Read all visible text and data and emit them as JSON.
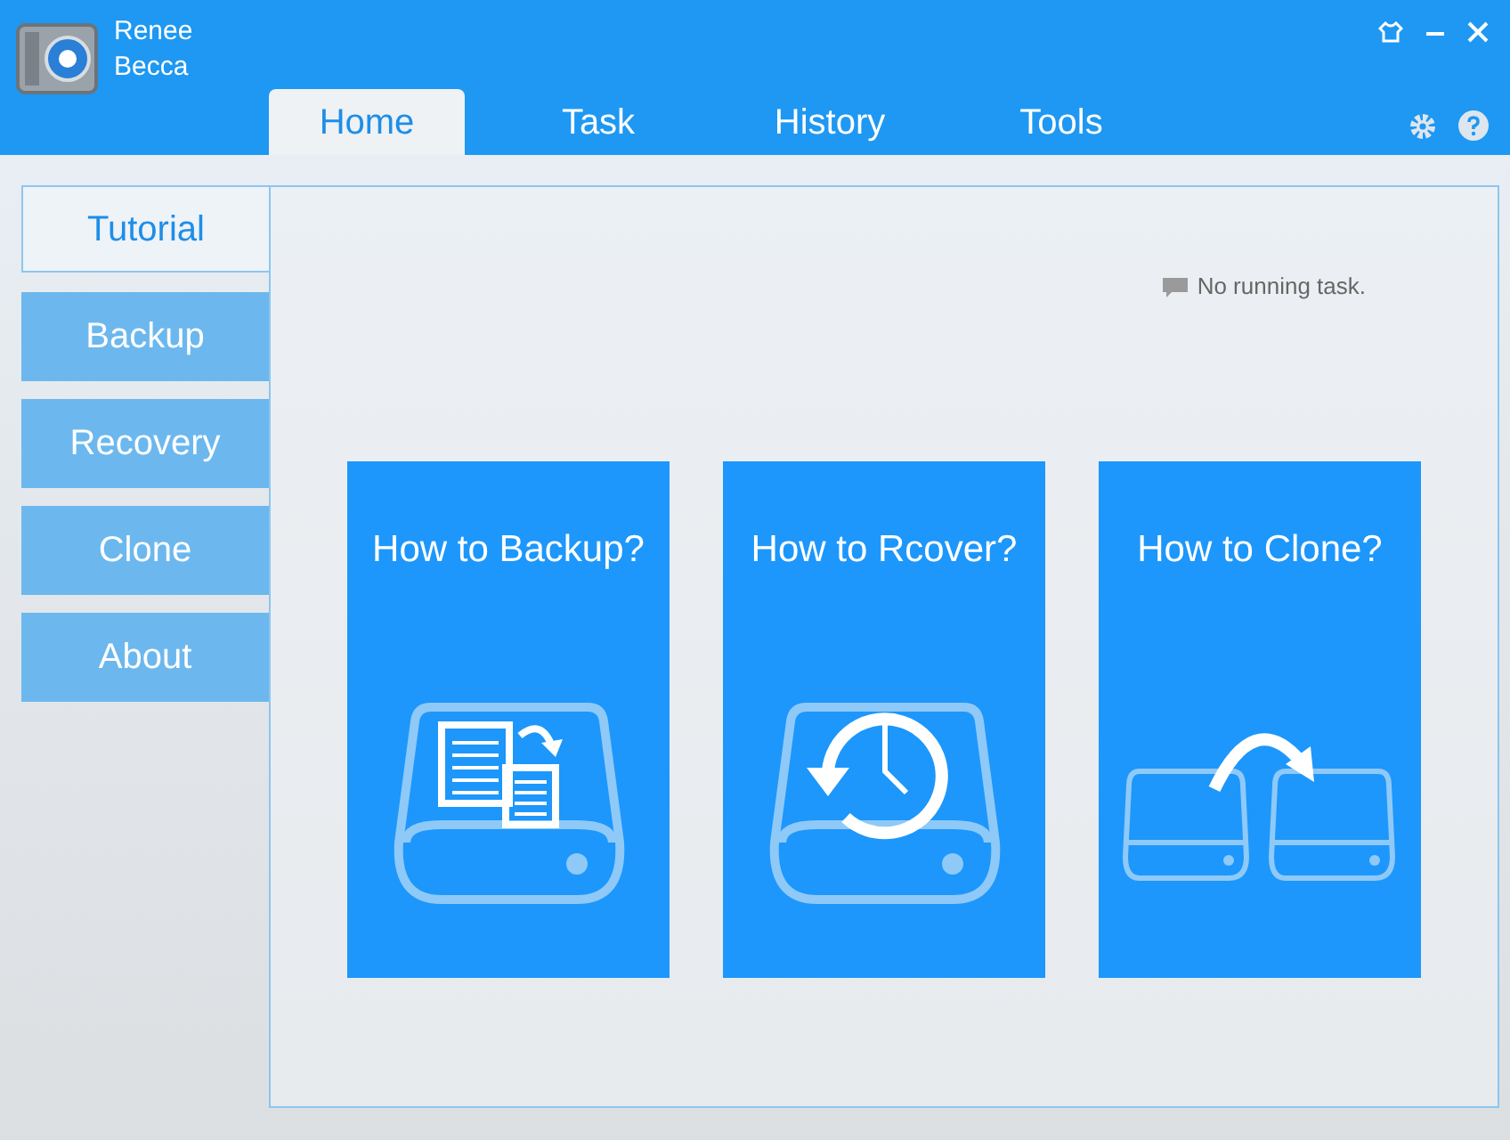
{
  "app": {
    "name_line1": "Renee",
    "name_line2": "Becca"
  },
  "tabs": [
    {
      "label": "Home",
      "selected": true
    },
    {
      "label": "Task",
      "selected": false
    },
    {
      "label": "History",
      "selected": false
    },
    {
      "label": "Tools",
      "selected": false
    }
  ],
  "sidebar": {
    "items": [
      {
        "label": "Tutorial",
        "selected": true
      },
      {
        "label": "Backup",
        "selected": false
      },
      {
        "label": "Recovery",
        "selected": false
      },
      {
        "label": "Clone",
        "selected": false
      },
      {
        "label": "About",
        "selected": false
      }
    ]
  },
  "status": "No running task.",
  "cards": [
    {
      "title": "How to Backup?",
      "kind": "backup"
    },
    {
      "title": "How to Rcover?",
      "kind": "recovery"
    },
    {
      "title": "How to Clone?",
      "kind": "clone"
    }
  ]
}
